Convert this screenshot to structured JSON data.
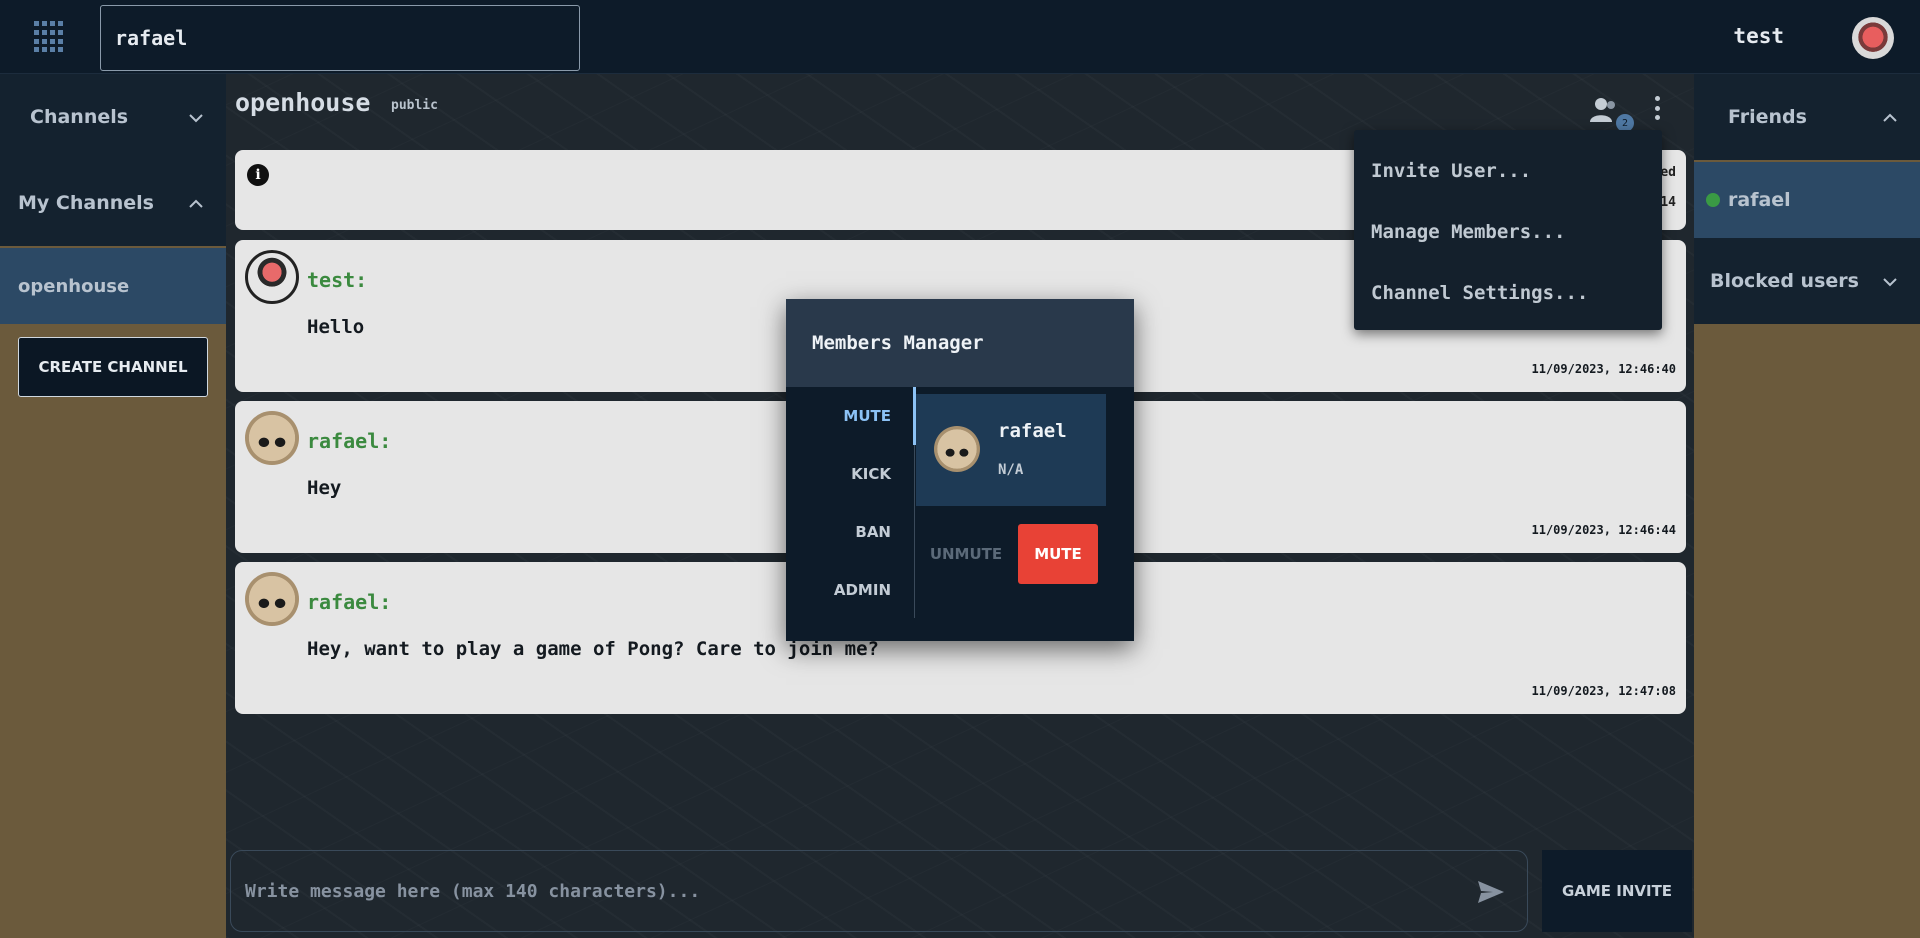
{
  "topbar": {
    "search_value": "rafael",
    "username": "test"
  },
  "left_sidebar": {
    "channels_label": "Channels",
    "my_channels_label": "My Channels",
    "channels": [
      "openhouse"
    ],
    "create_channel_label": "CREATE CHANNEL"
  },
  "chat": {
    "channel_name": "openhouse",
    "channel_visibility": "public",
    "members_count": "2",
    "info_trail_1": "ed",
    "info_trail_2": "14",
    "messages": [
      {
        "author": "test:",
        "text": "Hello",
        "time": "11/09/2023, 12:46:40"
      },
      {
        "author": "rafael:",
        "text": "Hey",
        "time": "11/09/2023, 12:46:44"
      },
      {
        "author": "rafael:",
        "text": "Hey, want to play a game of Pong? Care to join me?",
        "time": "11/09/2023, 12:47:08"
      }
    ],
    "composer_placeholder": "Write message here (max 140 characters)...",
    "game_invite_label": "GAME INVITE"
  },
  "dropdown": {
    "items": [
      "Invite User...",
      "Manage Members...",
      "Channel Settings..."
    ]
  },
  "right_sidebar": {
    "friends_label": "Friends",
    "friends": [
      {
        "name": "rafael",
        "status": "online"
      }
    ],
    "blocked_label": "Blocked users"
  },
  "modal": {
    "title": "Members Manager",
    "tabs": [
      "MUTE",
      "KICK",
      "BAN",
      "ADMIN"
    ],
    "active_tab": "MUTE",
    "member": {
      "name": "rafael",
      "status": "N/A"
    },
    "unmute_label": "UNMUTE",
    "mute_label": "MUTE"
  },
  "colors": {
    "topbar_bg": "#0d1b29",
    "accent_blue": "#8cc2f5",
    "author_green": "#3b8a3f",
    "mute_red": "#e84236",
    "online_green": "#3a9a44"
  }
}
